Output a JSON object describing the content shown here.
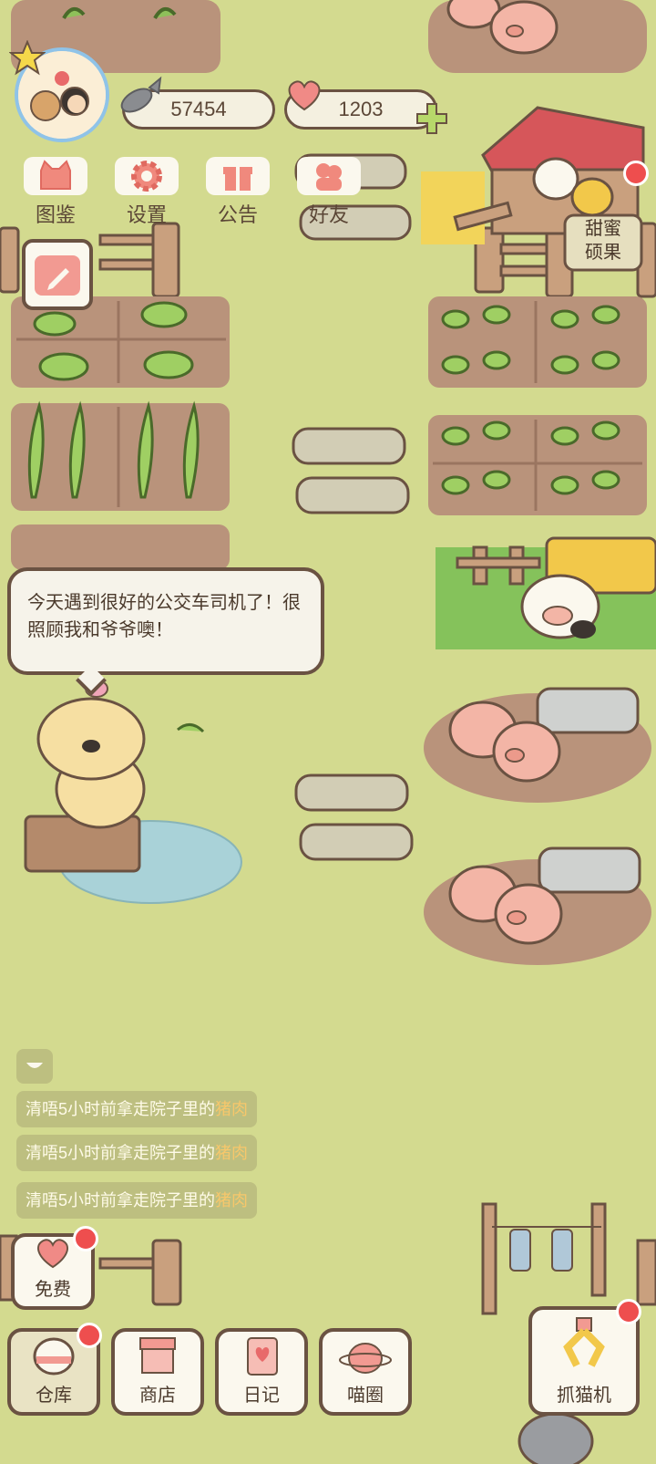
{
  "stats": {
    "fish": "57454",
    "hearts": "1203"
  },
  "menu": {
    "guide_label": "图鉴",
    "settings_label": "设置",
    "notice_label": "公告",
    "friends_label": "好友"
  },
  "signpost": {
    "line1": "甜蜜",
    "line2": "硕果"
  },
  "speech": {
    "text": "今天遇到很好的公交车司机了！很照顾我和爷爷噢！"
  },
  "log": {
    "entries": [
      {
        "prefix": "清唔5小时前拿走院子里的",
        "item": "猪肉"
      },
      {
        "prefix": "清唔5小时前拿走院子里的",
        "item": "猪肉"
      },
      {
        "prefix": "清唔5小时前拿走院子里的",
        "item": "猪肉"
      }
    ]
  },
  "bottom": {
    "free_label": "免费",
    "storage_label": "仓库",
    "shop_label": "商店",
    "diary_label": "日记",
    "circle_label": "喵圈",
    "claw_label": "抓猫机"
  },
  "colors": {
    "grass": "#d3da8f",
    "soil": "#b9937b",
    "badge": "#ee4e4e",
    "pig": "#f3b5a6",
    "outline": "#6a5242"
  }
}
